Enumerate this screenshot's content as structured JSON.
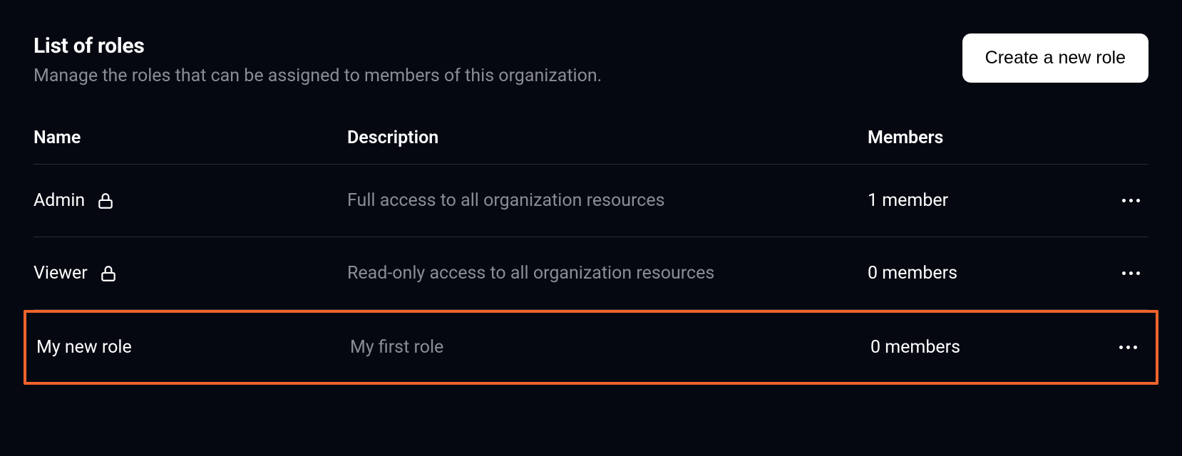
{
  "header": {
    "title": "List of roles",
    "subtitle": "Manage the roles that can be assigned to members of this organization.",
    "create_button": "Create a new role"
  },
  "table": {
    "columns": {
      "name": "Name",
      "description": "Description",
      "members": "Members"
    },
    "rows": [
      {
        "name": "Admin",
        "locked": true,
        "description": "Full access to all organization resources",
        "members": "1 member",
        "highlighted": false
      },
      {
        "name": "Viewer",
        "locked": true,
        "description": "Read-only access to all organization resources",
        "members": "0 members",
        "highlighted": false
      },
      {
        "name": "My new role",
        "locked": false,
        "description": "My first role",
        "members": "0 members",
        "highlighted": true
      }
    ]
  }
}
